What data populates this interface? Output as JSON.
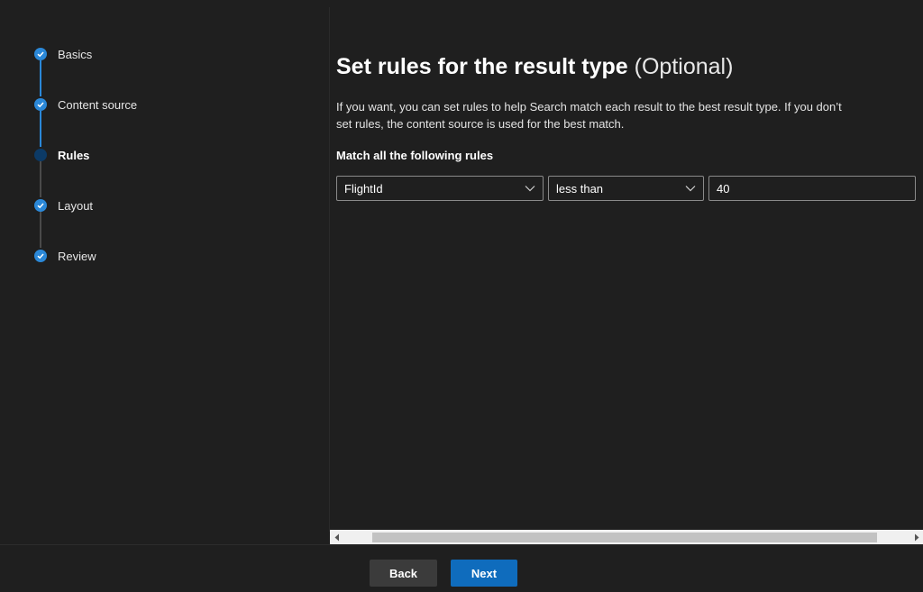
{
  "wizard": {
    "steps": [
      {
        "label": "Basics",
        "state": "completed"
      },
      {
        "label": "Content source",
        "state": "completed"
      },
      {
        "label": "Rules",
        "state": "current"
      },
      {
        "label": "Layout",
        "state": "completed"
      },
      {
        "label": "Review",
        "state": "completed"
      }
    ]
  },
  "main": {
    "title": "Set rules for the result type",
    "title_optional": "(Optional)",
    "description": "If you want, you can set rules to help Search match each result to the best result type. If you don’t set rules, the content source is used for the best match.",
    "rules_heading": "Match all the following rules",
    "rule": {
      "property": "FlightId",
      "operator": "less than",
      "value": "40"
    }
  },
  "footer": {
    "back_label": "Back",
    "next_label": "Next"
  },
  "colors": {
    "background": "#1f1f1f",
    "accent": "#2b88d8",
    "primary_button": "#0f6cbd",
    "secondary_button": "#3b3b3b"
  },
  "icons": {
    "completed_step": "checkmark-icon",
    "dropdown": "chevron-down-icon",
    "scroll_left": "scroll-left-arrow-icon",
    "scroll_right": "scroll-right-arrow-icon"
  }
}
